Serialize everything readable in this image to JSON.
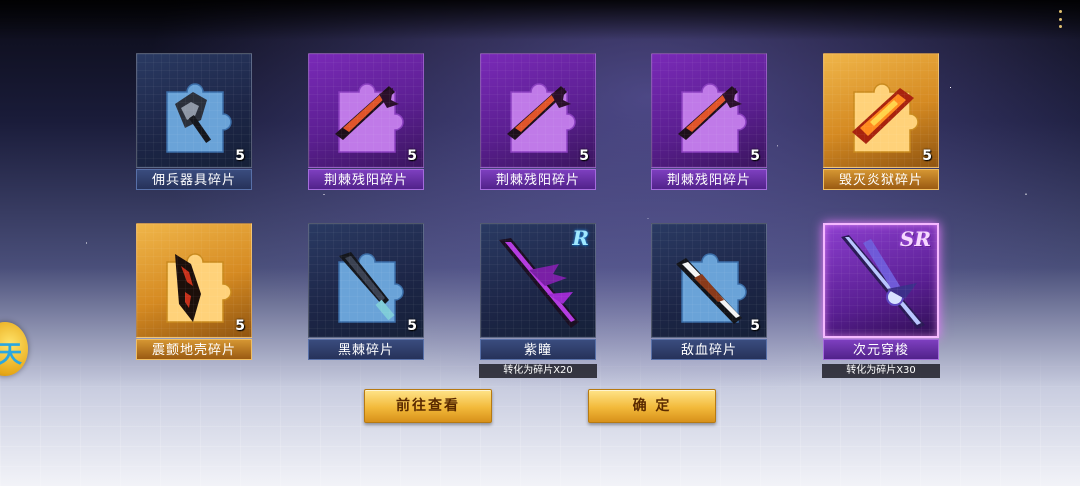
{
  "rows": [
    [
      {
        "name": "佣兵器具碎片",
        "count": "5",
        "quality": "blue",
        "icon": "axe-puzzle-icon"
      },
      {
        "name": "荆棘残阳碎片",
        "count": "5",
        "quality": "purple",
        "icon": "thorn-blade-puzzle-icon"
      },
      {
        "name": "荆棘残阳碎片",
        "count": "5",
        "quality": "purple",
        "icon": "thorn-blade-puzzle-icon"
      },
      {
        "name": "荆棘残阳碎片",
        "count": "5",
        "quality": "purple",
        "icon": "thorn-blade-puzzle-icon"
      },
      {
        "name": "毁灭炎狱碎片",
        "count": "5",
        "quality": "gold",
        "icon": "flame-blade-puzzle-icon"
      }
    ],
    [
      {
        "name": "震颤地壳碎片",
        "count": "5",
        "quality": "gold",
        "icon": "rock-blade-puzzle-icon"
      },
      {
        "name": "黑棘碎片",
        "count": "5",
        "quality": "blue",
        "icon": "black-blade-puzzle-icon"
      },
      {
        "name": "紫瞳",
        "rank": "R",
        "quality": "blue",
        "icon": "purple-scythe-icon",
        "note": "转化为碎片X20"
      },
      {
        "name": "敌血碎片",
        "count": "5",
        "quality": "blue",
        "icon": "blood-blade-puzzle-icon"
      },
      {
        "name": "次元穿梭",
        "rank": "SR",
        "quality": "sr",
        "icon": "dimension-sword-icon",
        "note": "转化为碎片X30"
      }
    ]
  ],
  "buttons": {
    "goto_label": "前往查看",
    "confirm_label": "确 定"
  },
  "side_badge": "天",
  "colors": {
    "blue": "#26325a",
    "purple": "#5c1f92",
    "gold": "#d58a22",
    "sr_glow": "#e87bff",
    "button": "#f2b93a"
  }
}
